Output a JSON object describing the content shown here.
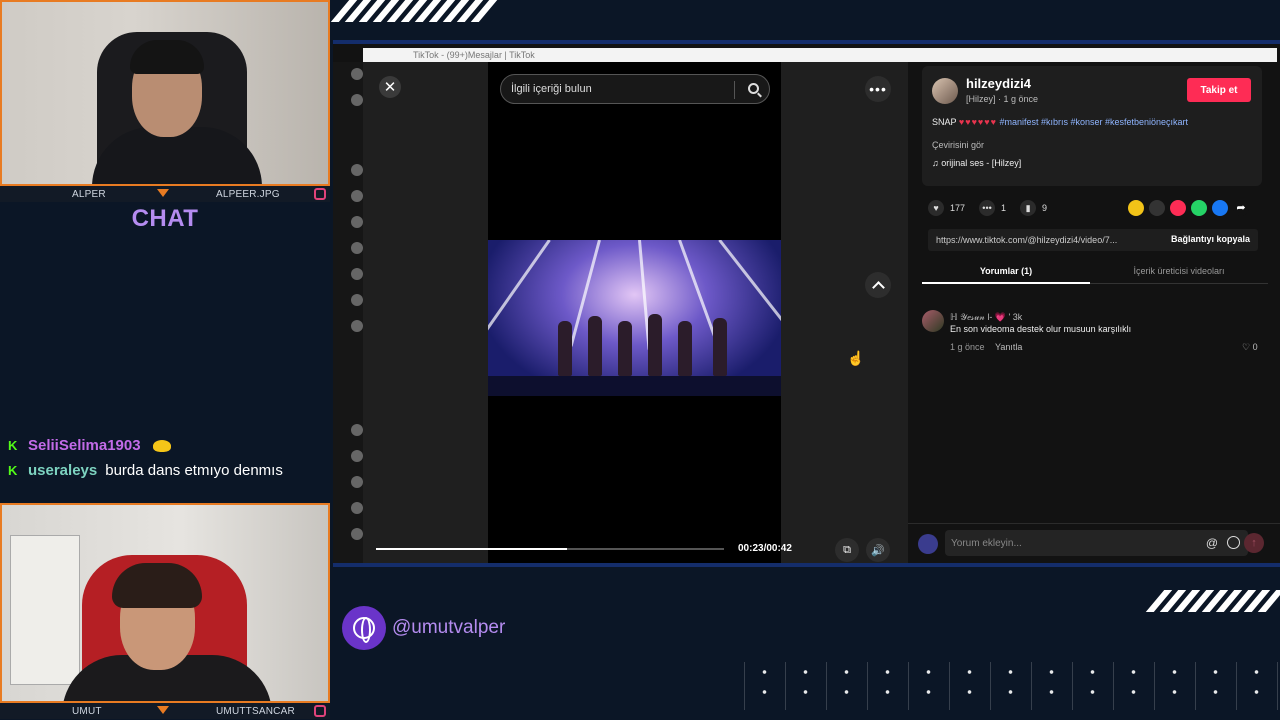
{
  "overlay": {
    "top_cam": {
      "name_left": "ALPER",
      "name_right": "ALPEER.JPG"
    },
    "bottom_cam": {
      "name_left": "UMUT",
      "name_right": "UMUTTSANCAR"
    },
    "chat_title": "CHAT",
    "chat_messages": [
      {
        "user": "SeliiSelima1903",
        "text": ""
      },
      {
        "user": "useraleys",
        "text": "burda dans etmıyo denmıs"
      }
    ],
    "handle": "@umutvalper",
    "accent_color": "#e87b22",
    "brand_purple": "#6a34c9"
  },
  "browser": {
    "tab_title": "TikTok - (99+)Mesajlar | TikTok"
  },
  "tiktok": {
    "search_placeholder": "İlgili içeriği bulun",
    "video": {
      "time": "00:23/00:42",
      "progress_fraction": 0.55
    },
    "post": {
      "author": "hilzeydizi4",
      "meta": "[Hilzey] · 1 g önce",
      "follow_label": "Takip et",
      "description_prefix": "SNAP",
      "hashtags": "#manifest #kıbrıs #konser #kesfetbeniöneçıkart",
      "translate_label": "Çevirisini gör",
      "sound": "orijinal ses - [Hilzey]",
      "likes": "177",
      "comments": "1",
      "saves": "9",
      "link": "https://www.tiktok.com/@hilzeydizi4/video/7...",
      "copy_label": "Bağlantıyı kopyala"
    },
    "tabs": {
      "comments": "Yorumlar (1)",
      "creator_videos": "İçerik üreticisi videoları"
    },
    "comment": {
      "user": "ℍ 𝒴𝑒𝓈𝓊𝓃 l- 💗 ' 3k",
      "text": "En son videoma destek olur musuun karşılıklı",
      "time": "1 g önce",
      "reply": "Yanıtla",
      "likes": "0"
    },
    "composer_placeholder": "Yorum ekleyin..."
  }
}
